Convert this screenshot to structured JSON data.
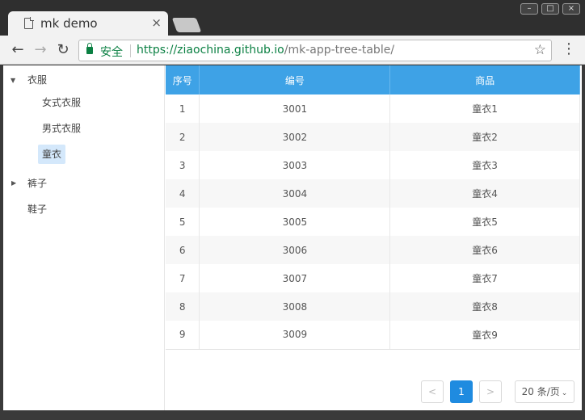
{
  "browser": {
    "tab_title": "mk demo",
    "tab_close": "×",
    "secure_label": "安全",
    "url_host": "https://ziaochina.github.io",
    "url_path": "/mk-app-tree-table/"
  },
  "icons": {
    "back": "←",
    "forward": "→",
    "reload": "↻",
    "star": "☆",
    "menu": "⋮",
    "caret_down": "▼",
    "caret_right": "▶"
  },
  "tree": {
    "nodes": [
      {
        "label": "衣服",
        "expanded": true
      },
      {
        "label": "女式衣服"
      },
      {
        "label": "男式衣服"
      },
      {
        "label": "童衣",
        "selected": true
      },
      {
        "label": "裤子",
        "expanded": false
      },
      {
        "label": "鞋子"
      }
    ]
  },
  "table": {
    "headers": [
      "序号",
      "编号",
      "商品"
    ],
    "rows": [
      [
        "1",
        "3001",
        "童衣1"
      ],
      [
        "2",
        "3002",
        "童衣2"
      ],
      [
        "3",
        "3003",
        "童衣3"
      ],
      [
        "4",
        "3004",
        "童衣4"
      ],
      [
        "5",
        "3005",
        "童衣5"
      ],
      [
        "6",
        "3006",
        "童衣6"
      ],
      [
        "7",
        "3007",
        "童衣7"
      ],
      [
        "8",
        "3008",
        "童衣8"
      ],
      [
        "9",
        "3009",
        "童衣9"
      ]
    ]
  },
  "pagination": {
    "prev": "<",
    "current": "1",
    "next": ">",
    "page_size": "20 条/页"
  },
  "colors": {
    "header_bg": "#3ea2e6",
    "selected_node_bg": "#d4e8fb",
    "active_page": "#1f8be0",
    "secure_green": "#0b8043"
  }
}
